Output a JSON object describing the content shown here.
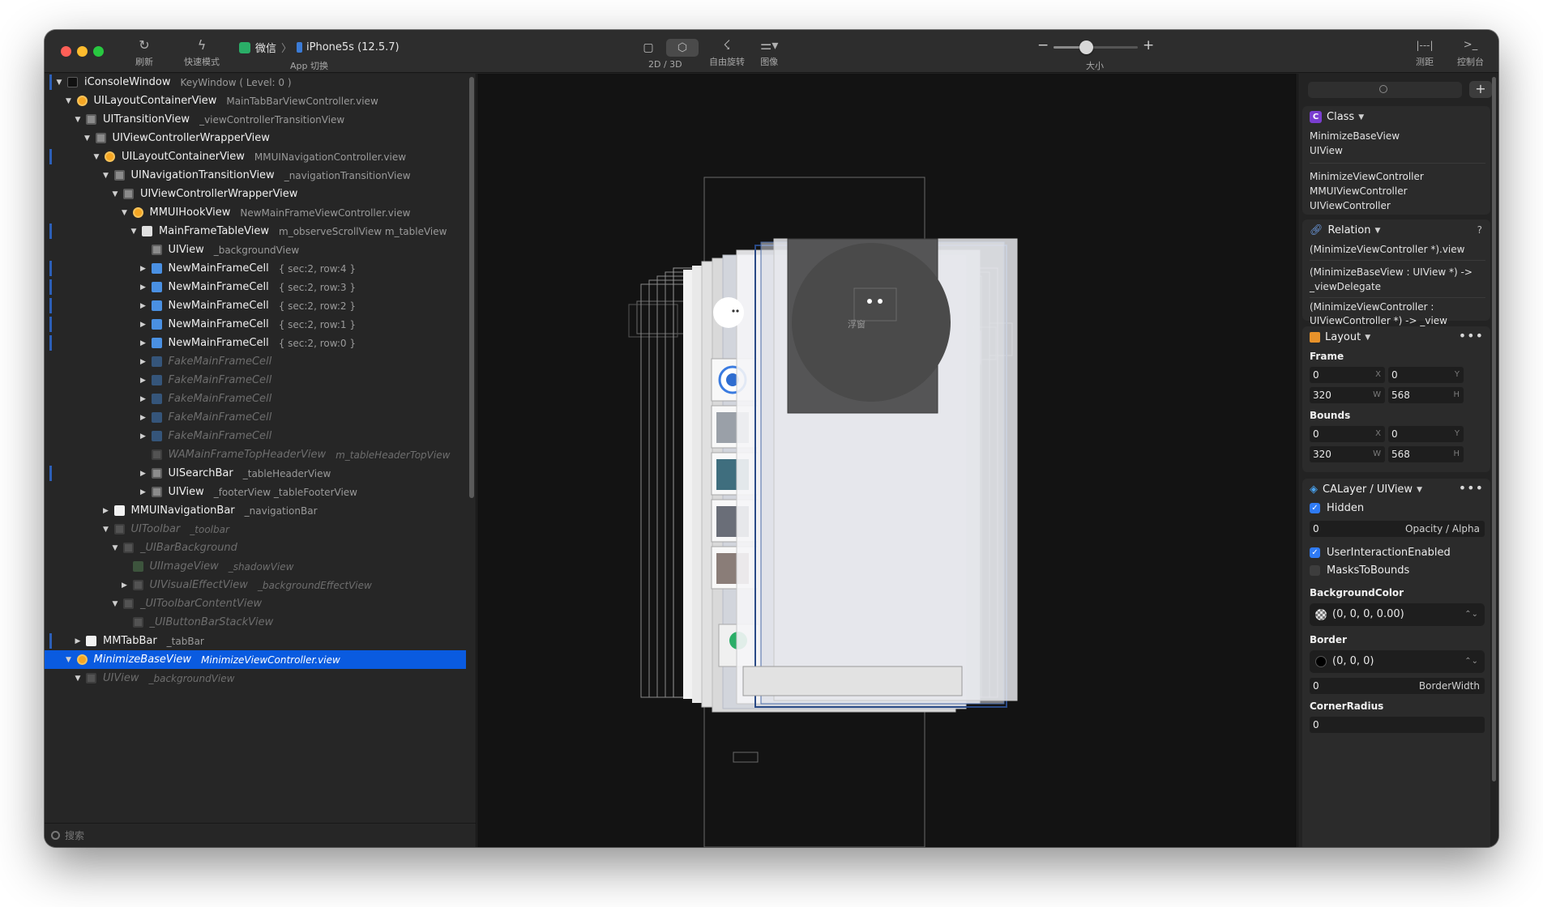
{
  "toolbar": {
    "refresh": "刷新",
    "fast_mode": "快速模式",
    "app_name": "微信",
    "device": "iPhone5s (12.5.7)",
    "app_switch": "App 切换",
    "view_mode": "2D / 3D",
    "free_rotate": "自由旋转",
    "image": "图像",
    "size": "大小",
    "size_level": 0.38,
    "measure": "测距",
    "console": "控制台"
  },
  "tree": {
    "search_placeholder": "搜索",
    "rows": [
      {
        "name": "iConsoleWindow",
        "sub": "KeyWindow ( Level: 0 )"
      },
      {
        "name": "UILayoutContainerView",
        "sub": "MainTabBarViewController.view"
      },
      {
        "name": "UITransitionView",
        "sub": "_viewControllerTransitionView"
      },
      {
        "name": "UIViewControllerWrapperView",
        "sub": ""
      },
      {
        "name": "UILayoutContainerView",
        "sub": "MMUINavigationController.view"
      },
      {
        "name": "UINavigationTransitionView",
        "sub": "_navigationTransitionView"
      },
      {
        "name": "UIViewControllerWrapperView",
        "sub": ""
      },
      {
        "name": "MMUIHookView",
        "sub": "NewMainFrameViewController.view"
      },
      {
        "name": "MainFrameTableView",
        "sub": "m_observeScrollView   m_tableView"
      },
      {
        "name": "UIView",
        "sub": "_backgroundView"
      },
      {
        "name": "NewMainFrameCell",
        "sub": "{ sec:2, row:4 }"
      },
      {
        "name": "NewMainFrameCell",
        "sub": "{ sec:2, row:3 }"
      },
      {
        "name": "NewMainFrameCell",
        "sub": "{ sec:2, row:2 }"
      },
      {
        "name": "NewMainFrameCell",
        "sub": "{ sec:2, row:1 }"
      },
      {
        "name": "NewMainFrameCell",
        "sub": "{ sec:2, row:0 }"
      },
      {
        "name": "FakeMainFrameCell",
        "sub": ""
      },
      {
        "name": "FakeMainFrameCell",
        "sub": ""
      },
      {
        "name": "FakeMainFrameCell",
        "sub": ""
      },
      {
        "name": "FakeMainFrameCell",
        "sub": ""
      },
      {
        "name": "FakeMainFrameCell",
        "sub": ""
      },
      {
        "name": "WAMainFrameTopHeaderView",
        "sub": "m_tableHeaderTopView"
      },
      {
        "name": "UISearchBar",
        "sub": "_tableHeaderView"
      },
      {
        "name": "UIView",
        "sub": "_footerView   _tableFooterView"
      },
      {
        "name": "MMUINavigationBar",
        "sub": "_navigationBar"
      },
      {
        "name": "UIToolbar",
        "sub": "_toolbar"
      },
      {
        "name": "_UIBarBackground",
        "sub": ""
      },
      {
        "name": "UIImageView",
        "sub": "_shadowView"
      },
      {
        "name": "UIVisualEffectView",
        "sub": "_backgroundEffectView"
      },
      {
        "name": "_UIToolbarContentView",
        "sub": ""
      },
      {
        "name": "_UIButtonBarStackView",
        "sub": ""
      },
      {
        "name": "MMTabBar",
        "sub": "_tabBar"
      },
      {
        "name": "MinimizeBaseView",
        "sub": "MinimizeViewController.view"
      },
      {
        "name": "UIView",
        "sub": "_backgroundView"
      }
    ]
  },
  "canvas": {
    "floating_label": "浮窗"
  },
  "inspector": {
    "class_card": {
      "title": "Class",
      "hierarchy": [
        "MinimizeBaseView",
        "UIView"
      ],
      "controllers": [
        "MinimizeViewController",
        "MMUIViewController",
        "UIViewController"
      ]
    },
    "relation_card": {
      "title": "Relation",
      "help": "?",
      "lines": [
        "(MinimizeViewController *).view",
        "(MinimizeBaseView : UIView *) ->",
        "_viewDelegate",
        "(MinimizeViewController :",
        "UIViewController *) -> _view"
      ]
    },
    "layout_card": {
      "title": "Layout",
      "frame_label": "Frame",
      "frame": {
        "x": "0",
        "y": "0",
        "w": "320",
        "h": "568"
      },
      "bounds_label": "Bounds",
      "bounds": {
        "x": "0",
        "y": "0",
        "w": "320",
        "h": "568"
      },
      "units": {
        "x": "X",
        "y": "Y",
        "w": "W",
        "h": "H"
      }
    },
    "layer_card": {
      "title": "CALayer / UIView",
      "hidden_label": "Hidden",
      "hidden": true,
      "opacity_value": "0",
      "opacity_label": "Opacity / Alpha",
      "interaction_label": "UserInteractionEnabled",
      "interaction": true,
      "masks_label": "MasksToBounds",
      "masks": false,
      "bg_color_label": "BackgroundColor",
      "bg_color": "(0, 0, 0, 0.00)",
      "border_label": "Border",
      "border_color": "(0, 0, 0)",
      "border_width_value": "0",
      "border_width_label": "BorderWidth",
      "corner_label": "CornerRadius",
      "corner_value": "0"
    }
  },
  "colors": {
    "selection": "#0a5be0",
    "checkbox": "#2f7bf5",
    "class_badge": "#7a3ed0",
    "wechat_green": "#2aae67"
  }
}
